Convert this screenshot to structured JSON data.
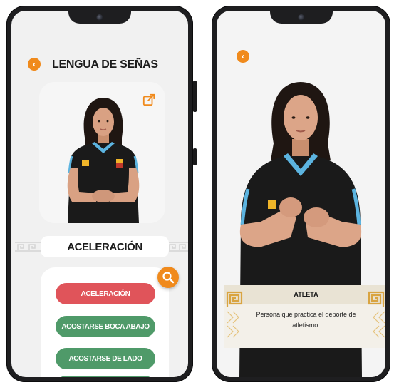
{
  "left_screen": {
    "header": {
      "title": "LENGUA DE SEÑAS"
    },
    "video": {
      "expand_icon": "open-external-icon"
    },
    "current_word": "ACELERACIÓN",
    "search": {
      "icon": "search-icon"
    },
    "word_list": [
      {
        "label": "ACELERACIÓN",
        "color": "#e0545a"
      },
      {
        "label": "ACOSTARSE BOCA ABAJO",
        "color": "#4f9a69"
      },
      {
        "label": "ACOSTARSE DE LADO",
        "color": "#4f9a69"
      },
      {
        "label": "",
        "color": "#4f9a69"
      }
    ]
  },
  "right_screen": {
    "caption": {
      "title": "ATLETA",
      "description": "Persona que practica el deporte de atletismo."
    }
  },
  "colors": {
    "accent_orange": "#f08a1c",
    "selected_red": "#e0545a",
    "word_green": "#4f9a69",
    "jersey_blue": "#5cb4e0",
    "jersey_black": "#1a1a1a",
    "caption_gold": "#d9a441"
  }
}
